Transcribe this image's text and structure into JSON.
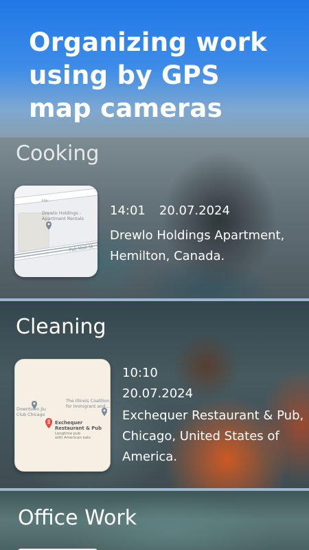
{
  "header": {
    "title": "Organizing work using by GPS map cameras"
  },
  "sections": [
    {
      "category": "Cooking",
      "time": "14:01",
      "date": "20.07.2024",
      "address": "Drewlo Holdings Apartment, Hemilton, Canada.",
      "map": {
        "place_name": "Drewlo Holdings - Apartment Rentals",
        "street_top": "Ha...",
        "street_bottom": "Pall Mall St"
      }
    },
    {
      "category": "Cleaning",
      "time": "10:10",
      "date": "20.07.2024",
      "address": "Exchequer Restaurant & Pub, Chicago, United States of America.",
      "map": {
        "poi_left": "Downtown Jiu Jitsu Club Chicago",
        "poi_right": "The Illinois Coalition for Immigrant and...",
        "poi_main": "Exchequer Restaurant & Pub",
        "poi_main_sub": "Longtime pub with American eats"
      }
    },
    {
      "category": "Office Work"
    }
  ],
  "colors": {
    "accent_blue": "#1f78e6",
    "divider": "#9db7d3",
    "pin": "#7a8a96",
    "restaurant_pin": "#e8453c"
  }
}
